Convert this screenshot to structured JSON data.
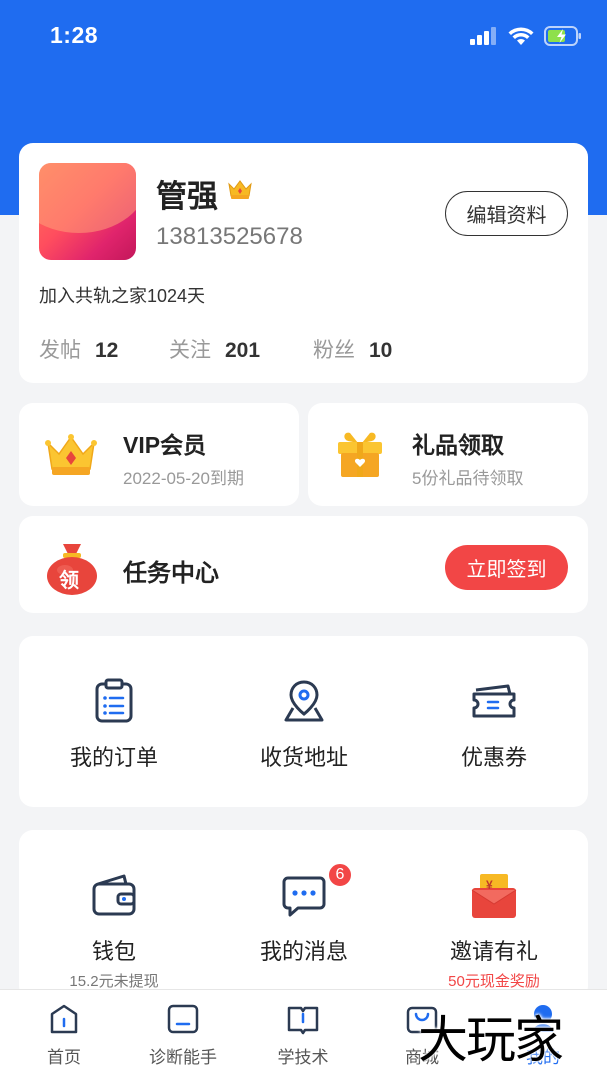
{
  "status_bar": {
    "time": "1:28"
  },
  "profile": {
    "name": "管强",
    "phone": "13813525678",
    "edit_label": "编辑资料",
    "join_text": "加入共轨之家1024天",
    "stats": [
      {
        "label": "发帖",
        "value": "12"
      },
      {
        "label": "关注",
        "value": "201"
      },
      {
        "label": "粉丝",
        "value": "10"
      }
    ]
  },
  "vip": {
    "title": "VIP会员",
    "subtitle": "2022-05-20到期"
  },
  "gift": {
    "title": "礼品领取",
    "subtitle": "5份礼品待领取"
  },
  "task": {
    "icon_text": "领",
    "title": "任务中心",
    "button_label": "立即签到"
  },
  "services": [
    {
      "label": "我的订单",
      "icon": "order-icon"
    },
    {
      "label": "收货地址",
      "icon": "location-icon"
    },
    {
      "label": "优惠券",
      "icon": "coupon-icon"
    }
  ],
  "features": [
    {
      "label": "钱包",
      "sub": "15.2元未提现",
      "icon": "wallet-icon"
    },
    {
      "label": "我的消息",
      "badge": "6",
      "icon": "message-icon"
    },
    {
      "label": "邀请有礼",
      "sub": "50元现金奖励",
      "icon": "red-envelope-icon",
      "envelope_text": "¥"
    }
  ],
  "tabs": [
    {
      "label": "首页",
      "icon": "home-icon"
    },
    {
      "label": "诊断能手",
      "icon": "diagnosis-icon"
    },
    {
      "label": "学技术",
      "icon": "book-icon"
    },
    {
      "label": "商城",
      "icon": "shop-icon"
    },
    {
      "label": "我的",
      "icon": "profile-icon",
      "active": true
    }
  ],
  "watermark": "大玩家",
  "colors": {
    "brand_blue": "#1f6cf0",
    "accent_red": "#f24646",
    "gold": "#f7b924"
  }
}
